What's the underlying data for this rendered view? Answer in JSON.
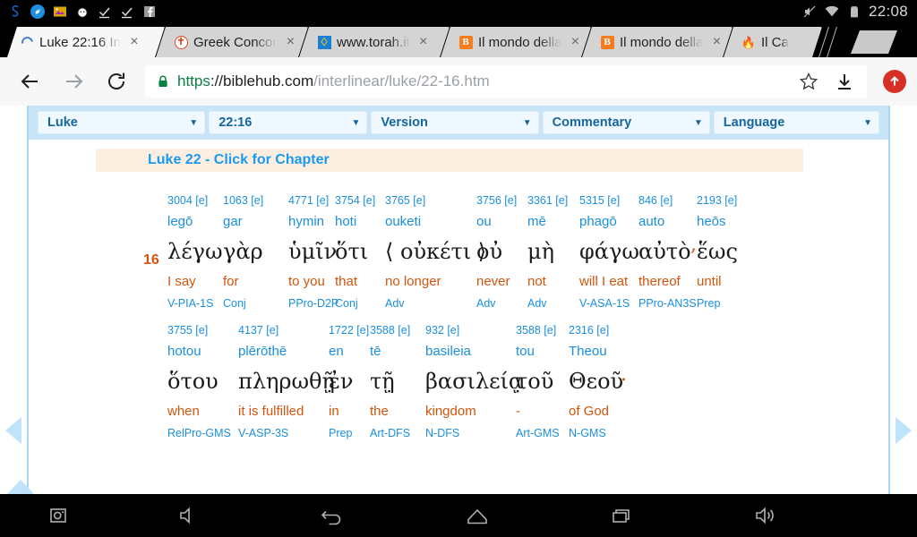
{
  "statusbar": {
    "left_icons": [
      "s-logo-icon",
      "rocket-icon",
      "photos-icon",
      "app-icon",
      "checkmark-icon",
      "checkmark-icon",
      "facebook-icon"
    ],
    "mute_icon": "sound-muted-icon",
    "wifi_icon": "wifi-icon",
    "battery_icon": "battery-icon",
    "clock": "22:08"
  },
  "tabs": [
    {
      "title": "Luke 22:16 In",
      "favicon": "loading-spinner-icon",
      "active": true,
      "close": "×"
    },
    {
      "title": "Greek Concor",
      "favicon": "greek-concordance-icon",
      "active": false,
      "close": "×"
    },
    {
      "title": "www.torah.it",
      "favicon": "torah-icon",
      "active": false,
      "close": "×"
    },
    {
      "title": "Il mondo della",
      "favicon": "blogger-icon",
      "active": false,
      "close": "×"
    },
    {
      "title": "Il mondo della",
      "favicon": "blogger-icon",
      "active": false,
      "close": "×"
    },
    {
      "title": "Il Ca",
      "favicon": "flame-icon",
      "active": false,
      "close": ""
    }
  ],
  "omnibox": {
    "back_icon": "back-arrow-icon",
    "forward_icon": "forward-arrow-icon",
    "reload_icon": "reload-icon",
    "lock_icon": "lock-icon",
    "url_scheme": "https",
    "url_host": "://biblehub.com",
    "url_path": "/interlinear/luke/22-16.htm",
    "url_full": "https://biblehub.com/interlinear/luke/22-16.htm",
    "star_icon": "bookmark-star-icon",
    "download_icon": "download-icon",
    "profile_icon": "profile-update-icon"
  },
  "selectors": [
    {
      "label": "Luke",
      "caret": "▼"
    },
    {
      "label": "22:16",
      "caret": "▼"
    },
    {
      "label": "Version",
      "caret": "▼"
    },
    {
      "label": "Commentary",
      "caret": "▼"
    },
    {
      "label": "Language",
      "caret": "▼"
    }
  ],
  "chapter_link": "Luke 22 - Click for Chapter",
  "verse_number": "16",
  "interlinear": {
    "row1": [
      {
        "strong": "3004 [e]",
        "translit": "legō",
        "greek": "λέγω",
        "english": "I say",
        "parse": "V-PIA-1S",
        "w": 62
      },
      {
        "strong": "1063 [e]",
        "translit": "gar",
        "greek": "γὰρ",
        "english": "for",
        "parse": "Conj",
        "w": 73
      },
      {
        "strong": "4771 [e]",
        "translit": "hymin",
        "greek": "ὑμῖν",
        "english": "to you",
        "parse": "PPro-D2P",
        "w": 52
      },
      {
        "strong": "3754 [e]",
        "translit": "hoti",
        "greek": "ὅτι",
        "english": "that",
        "parse": "Conj",
        "w": 56
      },
      {
        "strong": "3765 [e]",
        "translit": "ouketi",
        "greek": "⟨ οὐκέτι ⟩",
        "english": "no longer",
        "parse": "Adv",
        "w": 102
      },
      {
        "strong": "3756 [e]",
        "translit": "ou",
        "greek": "οὐ",
        "english": "never",
        "parse": "Adv",
        "w": 57
      },
      {
        "strong": "3361 [e]",
        "translit": "mē",
        "greek": "μὴ",
        "english": "not",
        "parse": "Adv",
        "w": 58
      },
      {
        "strong": "5315 [e]",
        "translit": "phagō",
        "greek": "φάγω",
        "english": "will I eat",
        "parse": "V-ASA-1S",
        "w": 66
      },
      {
        "strong": "846 [e]",
        "translit": "auto",
        "greek": "αὐτὸ",
        "english": "thereof",
        "parse": "PPro-AN3S",
        "w": 58,
        "punct": ","
      },
      {
        "strong": "2193 [e]",
        "translit": "heōs",
        "greek": "ἕως",
        "english": "until",
        "parse": "Prep",
        "w": 58
      }
    ],
    "row2": [
      {
        "strong": "3755 [e]",
        "translit": "hotou",
        "greek": "ὅτου",
        "english": "when",
        "parse": "RelPro-GMS",
        "w": 79
      },
      {
        "strong": "4137 [e]",
        "translit": "plērōthē",
        "greek": "πληρωθῇ̣",
        "english": "it is fulfilled",
        "parse": "V-ASP-3S",
        "w": 101
      },
      {
        "strong": "1722 [e]",
        "translit": "en",
        "greek": "ἐν",
        "english": "in",
        "parse": "Prep",
        "w": 46
      },
      {
        "strong": "3588 [e]",
        "translit": "tē",
        "greek": "τῇ̣",
        "english": "the",
        "parse": "Art-DFS",
        "w": 62
      },
      {
        "strong": "932 [e]",
        "translit": "basileia",
        "greek": "βασιλείᾳ̣",
        "english": "kingdom",
        "parse": "N-DFS",
        "w": 101
      },
      {
        "strong": "3588 [e]",
        "translit": "tou",
        "greek": "τοῦ",
        "english": "-",
        "parse": "Art-GMS",
        "w": 59
      },
      {
        "strong": "2316 [e]",
        "translit": "Theou",
        "greek": "Θεοῦ",
        "english": "of God",
        "parse": "N-GMS",
        "w": 58,
        "punct": "."
      }
    ]
  },
  "page_nav": {
    "prev_icon": "previous-verse-arrow-icon",
    "next_icon": "next-verse-arrow-icon",
    "top_icon": "scroll-up-arrow-icon"
  },
  "navbar": {
    "buttons": [
      {
        "name": "screenshot-button",
        "icon": "camera-icon"
      },
      {
        "name": "volume-down-button",
        "icon": "volume-low-icon"
      },
      {
        "name": "back-button",
        "icon": "back-icon"
      },
      {
        "name": "home-button",
        "icon": "home-icon"
      },
      {
        "name": "recents-button",
        "icon": "recents-icon"
      },
      {
        "name": "volume-up-button",
        "icon": "volume-high-icon"
      }
    ]
  },
  "colors": {
    "strong_blue": "#1a8fe0",
    "english_orange": "#d2540d",
    "select_blue": "#15659e",
    "selectbar_bg": "#c7e5f7",
    "chapter_bg": "#fdeee2"
  }
}
